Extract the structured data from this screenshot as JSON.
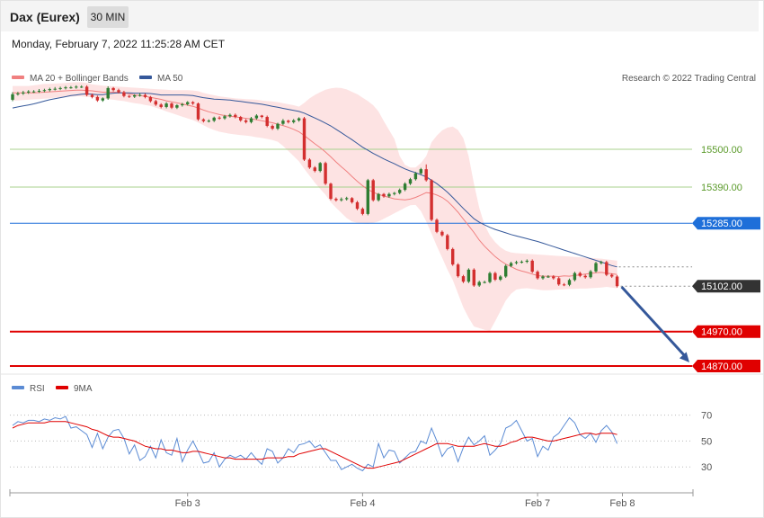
{
  "header": {
    "title": "Dax (Eurex)",
    "interval": "30 MIN"
  },
  "datetime": "Monday, February 7, 2022 11:25:28 AM CET",
  "credit": "Research © 2022 Trading Central",
  "colors": {
    "bullish": "#2e7d32",
    "bearish": "#d32f2f",
    "ma20": "#f08080",
    "bollinger_fill": "#fde3e3",
    "ma50": "#35589a",
    "resistance": "#a8d08d",
    "pivot": "#1e6fd9",
    "support": "#e00000",
    "current": "#333333",
    "rsi": "#5b8bd4",
    "rsi_ma": "#e00000"
  },
  "chart_data": [
    {
      "type": "candlestick",
      "legend": [
        {
          "name": "MA 20 + Bollinger Bands",
          "color": "#f08080"
        },
        {
          "name": "MA 50",
          "color": "#35589a"
        }
      ],
      "x_ticks": [
        {
          "label": "Feb 3",
          "index": 33
        },
        {
          "label": "Feb 4",
          "index": 66
        },
        {
          "label": "Feb 7",
          "index": 99
        },
        {
          "label": "Feb 8",
          "index": 115
        }
      ],
      "ylim": [
        14862,
        15683
      ],
      "levels": [
        {
          "value": 15500.0,
          "label": "15500.00",
          "kind": "resistance"
        },
        {
          "value": 15390.0,
          "label": "15390.00",
          "kind": "resistance"
        },
        {
          "value": 15285.0,
          "label": "15285.00",
          "kind": "pivot"
        },
        {
          "value": 15102.0,
          "label": "15102.00",
          "kind": "current"
        },
        {
          "value": 14970.0,
          "label": "14970.00",
          "kind": "support"
        },
        {
          "value": 14870.0,
          "label": "14870.00",
          "kind": "support"
        }
      ],
      "projection": {
        "from_value": 15100,
        "to_value": 14870
      },
      "close": [
        15660,
        15662,
        15665,
        15668,
        15668,
        15670,
        15672,
        15675,
        15676,
        15678,
        15680,
        15680,
        15682,
        15682,
        15658,
        15652,
        15642,
        15648,
        15678,
        15672,
        15666,
        15655,
        15653,
        15657,
        15658,
        15652,
        15640,
        15630,
        15623,
        15633,
        15621,
        15628,
        15631,
        15637,
        15633,
        15587,
        15582,
        15583,
        15592,
        15590,
        15596,
        15600,
        15594,
        15584,
        15579,
        15590,
        15598,
        15594,
        15568,
        15560,
        15574,
        15583,
        15579,
        15584,
        15590,
        15470,
        15447,
        15437,
        15460,
        15400,
        15356,
        15352,
        15355,
        15358,
        15346,
        15327,
        15312,
        15410,
        15352,
        15370,
        15363,
        15370,
        15373,
        15382,
        15400,
        15413,
        15430,
        15442,
        15410,
        15295,
        15260,
        15250,
        15210,
        15165,
        15131,
        15115,
        15150,
        15104,
        15114,
        15114,
        15140,
        15121,
        15130,
        15161,
        15169,
        15172,
        15173,
        15176,
        15144,
        15125,
        15130,
        15130,
        15125,
        15107,
        15106,
        15120,
        15140,
        15132,
        15128,
        15145,
        15169,
        15172,
        15135,
        15130,
        15102
      ],
      "open": [
        15644,
        15660,
        15662,
        15665,
        15668,
        15668,
        15670,
        15672,
        15675,
        15676,
        15678,
        15680,
        15680,
        15682,
        15682,
        15658,
        15652,
        15642,
        15648,
        15678,
        15672,
        15666,
        15655,
        15653,
        15657,
        15658,
        15652,
        15640,
        15630,
        15623,
        15633,
        15621,
        15628,
        15631,
        15637,
        15633,
        15587,
        15582,
        15583,
        15592,
        15590,
        15596,
        15600,
        15594,
        15584,
        15579,
        15590,
        15598,
        15594,
        15568,
        15560,
        15574,
        15583,
        15579,
        15584,
        15590,
        15470,
        15447,
        15437,
        15460,
        15400,
        15356,
        15352,
        15355,
        15358,
        15346,
        15327,
        15312,
        15410,
        15352,
        15370,
        15363,
        15370,
        15373,
        15382,
        15400,
        15413,
        15430,
        15442,
        15410,
        15295,
        15260,
        15250,
        15210,
        15165,
        15131,
        15115,
        15150,
        15104,
        15114,
        15114,
        15140,
        15121,
        15130,
        15161,
        15169,
        15172,
        15173,
        15176,
        15144,
        15125,
        15130,
        15130,
        15125,
        15107,
        15106,
        15120,
        15140,
        15132,
        15128,
        15145,
        15169,
        15172,
        15135,
        15130
      ],
      "high": [
        15666,
        15667,
        15670,
        15672,
        15672,
        15675,
        15676,
        15679,
        15681,
        15682,
        15684,
        15684,
        15686,
        15686,
        15686,
        15662,
        15656,
        15651,
        15683,
        15681,
        15676,
        15670,
        15658,
        15660,
        15663,
        15662,
        15655,
        15644,
        15634,
        15637,
        15636,
        15631,
        15635,
        15640,
        15640,
        15636,
        15590,
        15587,
        15595,
        15596,
        15600,
        15604,
        15604,
        15597,
        15588,
        15594,
        15602,
        15600,
        15598,
        15572,
        15577,
        15588,
        15586,
        15588,
        15593,
        15594,
        15474,
        15451,
        15463,
        15464,
        15403,
        15360,
        15360,
        15362,
        15361,
        15350,
        15331,
        15414,
        15414,
        15373,
        15373,
        15374,
        15376,
        15386,
        15404,
        15417,
        15434,
        15446,
        15456,
        15413,
        15299,
        15264,
        15254,
        15214,
        15169,
        15135,
        15154,
        15154,
        15118,
        15118,
        15144,
        15144,
        15134,
        15165,
        15173,
        15176,
        15177,
        15180,
        15180,
        15148,
        15134,
        15134,
        15134,
        15129,
        15111,
        15124,
        15144,
        15144,
        15136,
        15149,
        15173,
        15176,
        15176,
        15139,
        15134
      ],
      "low": [
        15640,
        15656,
        15658,
        15661,
        15664,
        15664,
        15666,
        15668,
        15671,
        15672,
        15674,
        15676,
        15676,
        15678,
        15654,
        15648,
        15638,
        15638,
        15644,
        15668,
        15662,
        15651,
        15649,
        15649,
        15653,
        15648,
        15636,
        15626,
        15619,
        15619,
        15617,
        15617,
        15624,
        15627,
        15629,
        15583,
        15578,
        15578,
        15579,
        15586,
        15586,
        15592,
        15590,
        15580,
        15575,
        15575,
        15586,
        15590,
        15564,
        15556,
        15556,
        15570,
        15575,
        15575,
        15580,
        15466,
        15443,
        15433,
        15433,
        15396,
        15352,
        15348,
        15348,
        15351,
        15342,
        15323,
        15308,
        15308,
        15348,
        15348,
        15359,
        15359,
        15366,
        15369,
        15378,
        15396,
        15409,
        15426,
        15406,
        15291,
        15256,
        15246,
        15206,
        15161,
        15127,
        15111,
        15111,
        15100,
        15100,
        15110,
        15110,
        15117,
        15117,
        15126,
        15157,
        15165,
        15168,
        15169,
        15140,
        15121,
        15121,
        15126,
        15121,
        15103,
        15102,
        15102,
        15116,
        15128,
        15124,
        15124,
        15141,
        15165,
        15131,
        15126,
        15098
      ],
      "ma20": [
        15664,
        15664,
        15664,
        15664,
        15664,
        15665,
        15666,
        15667,
        15668,
        15669,
        15670,
        15671,
        15672,
        15672,
        15671,
        15670,
        15668,
        15666,
        15666,
        15666,
        15665,
        15664,
        15661,
        15658,
        15656,
        15654,
        15651,
        15648,
        15645,
        15641,
        15638,
        15635,
        15632,
        15628,
        15625,
        15620,
        15614,
        15609,
        15605,
        15601,
        15598,
        15596,
        15594,
        15592,
        15590,
        15588,
        15586,
        15583,
        15580,
        15577,
        15573,
        15569,
        15564,
        15558,
        15551,
        15540,
        15528,
        15516,
        15505,
        15492,
        15478,
        15463,
        15449,
        15436,
        15421,
        15407,
        15394,
        15383,
        15375,
        15369,
        15364,
        15360,
        15356,
        15354,
        15353,
        15355,
        15360,
        15367,
        15374,
        15372,
        15367,
        15360,
        15349,
        15334,
        15317,
        15297,
        15278,
        15258,
        15236,
        15218,
        15203,
        15188,
        15176,
        15166,
        15159,
        15151,
        15146,
        15142,
        15137,
        15133,
        15131,
        15131,
        15131,
        15130,
        15132,
        15131,
        15133,
        15135,
        15137,
        15139,
        15141,
        15142,
        15140,
        15138,
        15136
      ],
      "bb_upper": [
        15684,
        15684,
        15684,
        15684,
        15686,
        15688,
        15690,
        15690,
        15691,
        15692,
        15693,
        15694,
        15695,
        15695,
        15693,
        15689,
        15687,
        15685,
        15684,
        15683,
        15682,
        15681,
        15680,
        15679,
        15678,
        15677,
        15676,
        15675,
        15674,
        15673,
        15672,
        15672,
        15672,
        15672,
        15671,
        15669,
        15664,
        15660,
        15657,
        15654,
        15652,
        15650,
        15648,
        15647,
        15646,
        15645,
        15644,
        15642,
        15640,
        15639,
        15637,
        15634,
        15631,
        15628,
        15624,
        15635,
        15648,
        15658,
        15666,
        15673,
        15677,
        15679,
        15678,
        15674,
        15667,
        15660,
        15650,
        15640,
        15628,
        15610,
        15582,
        15556,
        15530,
        15480,
        15455,
        15447,
        15447,
        15460,
        15480,
        15520,
        15540,
        15555,
        15563,
        15566,
        15556,
        15532,
        15480,
        15400,
        15330,
        15280,
        15250,
        15230,
        15215,
        15205,
        15200,
        15198,
        15197,
        15196,
        15195,
        15194,
        15193,
        15192,
        15191,
        15190,
        15189,
        15188,
        15187,
        15186,
        15185,
        15184,
        15183,
        15182,
        15180,
        15178,
        15176
      ],
      "bb_lower": [
        15642,
        15642,
        15643,
        15644,
        15645,
        15646,
        15647,
        15648,
        15650,
        15651,
        15652,
        15653,
        15654,
        15654,
        15652,
        15651,
        15649,
        15647,
        15646,
        15644,
        15642,
        15640,
        15637,
        15634,
        15632,
        15629,
        15626,
        15621,
        15616,
        15610,
        15605,
        15600,
        15595,
        15590,
        15585,
        15578,
        15570,
        15562,
        15556,
        15551,
        15548,
        15545,
        15543,
        15541,
        15540,
        15538,
        15535,
        15533,
        15530,
        15527,
        15522,
        15510,
        15495,
        15480,
        15465,
        15443,
        15423,
        15403,
        15385,
        15368,
        15346,
        15330,
        15315,
        15300,
        15290,
        15286,
        15284,
        15283,
        15286,
        15290,
        15298,
        15306,
        15314,
        15322,
        15330,
        15337,
        15338,
        15320,
        15290,
        15255,
        15218,
        15185,
        15150,
        15120,
        15080,
        15040,
        15010,
        14985,
        14980,
        14975,
        14972,
        15000,
        15030,
        15060,
        15080,
        15092,
        15095,
        15096,
        15094,
        15092,
        15090,
        15090,
        15091,
        15092,
        15093,
        15094,
        15094,
        15095,
        15095,
        15096,
        15097,
        15098,
        15100,
        15098,
        15096
      ],
      "ma50": [
        15620,
        15623,
        15626,
        15629,
        15632,
        15636,
        15640,
        15644,
        15647,
        15650,
        15653,
        15656,
        15658,
        15660,
        15661,
        15660,
        15659,
        15659,
        15661,
        15663,
        15664,
        15664,
        15664,
        15663,
        15663,
        15663,
        15662,
        15660,
        15658,
        15658,
        15658,
        15658,
        15658,
        15657,
        15656,
        15653,
        15650,
        15648,
        15646,
        15645,
        15644,
        15643,
        15641,
        15639,
        15637,
        15635,
        15633,
        15631,
        15628,
        15625,
        15622,
        15619,
        15616,
        15613,
        15610,
        15605,
        15598,
        15591,
        15584,
        15576,
        15568,
        15558,
        15548,
        15538,
        15528,
        15517,
        15506,
        15497,
        15488,
        15480,
        15472,
        15465,
        15458,
        15450,
        15443,
        15437,
        15432,
        15426,
        15420,
        15410,
        15400,
        15388,
        15375,
        15360,
        15344,
        15328,
        15313,
        15298,
        15288,
        15280,
        15273,
        15267,
        15262,
        15257,
        15252,
        15248,
        15244,
        15240,
        15236,
        15232,
        15227,
        15222,
        15217,
        15212,
        15207,
        15202,
        15197,
        15192,
        15187,
        15182,
        15177,
        15172,
        15167,
        15162,
        15158
      ]
    },
    {
      "type": "line",
      "legend": [
        {
          "name": "RSI",
          "color": "#5b8bd4"
        },
        {
          "name": "9MA",
          "color": "#e00000"
        }
      ],
      "ylim": [
        10,
        85
      ],
      "y_ticks": [
        70,
        50,
        30
      ],
      "rsi": [
        62,
        65,
        64,
        66,
        66,
        65,
        67,
        66,
        68,
        67,
        69,
        60,
        61,
        58,
        55,
        45,
        56,
        44,
        53,
        58,
        59,
        52,
        40,
        47,
        35,
        38,
        46,
        37,
        51,
        41,
        39,
        52,
        34,
        43,
        50,
        42,
        33,
        34,
        41,
        30,
        36,
        39,
        37,
        39,
        36,
        41,
        36,
        32,
        44,
        42,
        33,
        37,
        44,
        41,
        47,
        48,
        50,
        45,
        47,
        41,
        35,
        35,
        28,
        30,
        32,
        29,
        27,
        32,
        30,
        48,
        37,
        43,
        42,
        33,
        37,
        41,
        42,
        50,
        48,
        60,
        50,
        38,
        44,
        46,
        34,
        45,
        53,
        47,
        50,
        54,
        39,
        43,
        48,
        60,
        62,
        66,
        58,
        50,
        52,
        38,
        46,
        43,
        53,
        56,
        62,
        68,
        64,
        55,
        52,
        56,
        49,
        58,
        62,
        57,
        48
      ],
      "rsi_ma": [
        60,
        62,
        63,
        64,
        64,
        64,
        64,
        65,
        65,
        65,
        65,
        64,
        63,
        62,
        61,
        59,
        58,
        56,
        54,
        53,
        53,
        52,
        51,
        50,
        48,
        46,
        45,
        44,
        44,
        43,
        43,
        42,
        41,
        41,
        42,
        42,
        41,
        40,
        39,
        38,
        37,
        37,
        36,
        36,
        36,
        36,
        36,
        36,
        37,
        37,
        37,
        37,
        38,
        38,
        40,
        41,
        42,
        43,
        44,
        44,
        42,
        40,
        38,
        36,
        34,
        32,
        30,
        29,
        29,
        30,
        31,
        32,
        33,
        34,
        36,
        38,
        40,
        42,
        44,
        46,
        48,
        48,
        48,
        47,
        46,
        46,
        46,
        46,
        47,
        48,
        47,
        46,
        46,
        47,
        49,
        50,
        52,
        53,
        53,
        52,
        51,
        50,
        50,
        51,
        52,
        53,
        54,
        55,
        56,
        56,
        55,
        56,
        56,
        56,
        55
      ]
    }
  ]
}
